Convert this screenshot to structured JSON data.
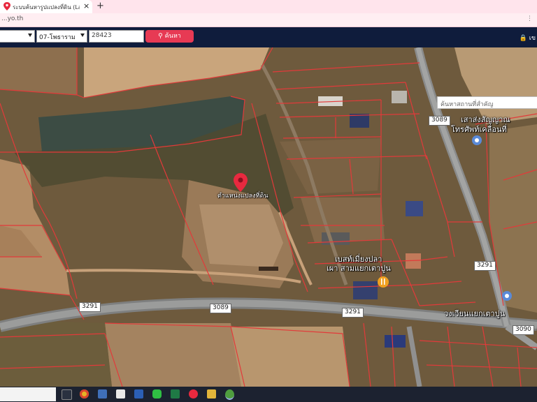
{
  "browser": {
    "tab_title": "ระบบค้นหารูปแปลงที่ดิน (LandsMaps)",
    "tab_close": "×",
    "new_tab": "+",
    "url": "...yo.th",
    "menu_glyph": "⋮"
  },
  "toolbar": {
    "amphoe_value": "",
    "tambon_value": "07-โพธาราม",
    "parcel_number": "28423",
    "search_label": "ค้นหา",
    "login_label": "เข"
  },
  "map": {
    "landmark_search_placeholder": "ค้นหาสถานที่สำคัญ",
    "parcel_label": "ตำแหน่งแปลงที่ดิน",
    "poi": [
      {
        "text": "เสาส่งสัญญาณ"
      },
      {
        "text": "โทรศัพท์เคลื่อนที่"
      },
      {
        "text": "เบสท์เมี่ยงปลา"
      },
      {
        "text": "เผา สามแยกเตาปูน"
      },
      {
        "text": "วงเวียนแยกเตาปูน"
      }
    ],
    "road_shields": [
      "3089",
      "3291",
      "3089",
      "3291",
      "3291",
      "3090"
    ]
  },
  "colors": {
    "brand_nav": "#0f1c3c",
    "search_button": "#e73a54",
    "parcel_lines": "#e23a3a",
    "marker": "#e8293f"
  }
}
